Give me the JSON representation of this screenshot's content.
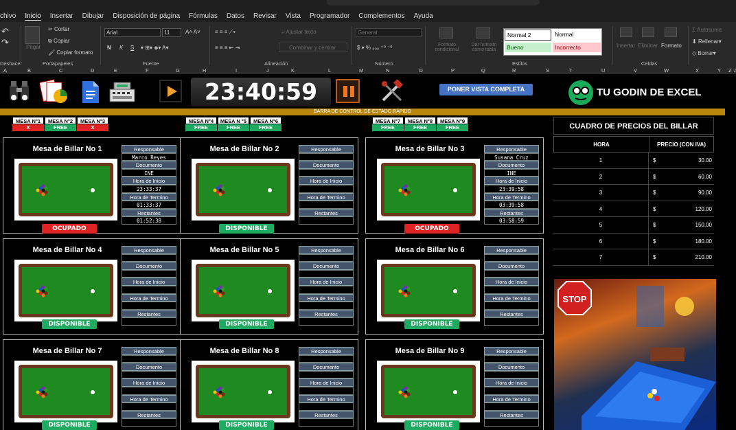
{
  "ribbon": {
    "tabs": [
      "chivo",
      "Inicio",
      "Insertar",
      "Dibujar",
      "Disposición de página",
      "Fórmulas",
      "Datos",
      "Revisar",
      "Vista",
      "Programador",
      "Complementos",
      "Ayuda"
    ],
    "active_tab": "Inicio",
    "undo_label": "Deshacer",
    "clipboard": {
      "cut": "Cortar",
      "copy": "Copiar",
      "format_painter": "Copiar formato",
      "paste": "Pegar",
      "group": "Portapapeles"
    },
    "font": {
      "family": "Arial",
      "size": "11",
      "bold": "N",
      "italic": "K",
      "underline": "S",
      "group": "Fuente"
    },
    "alignment": {
      "wrap": "Ajustar texto",
      "merge": "Combinar y centrar",
      "group": "Alineación"
    },
    "number": {
      "format": "General",
      "group": "Número"
    },
    "styles": {
      "cond_format": "Formato condicional",
      "format_table": "Dar formato como tabla",
      "normal2": "Normal 2",
      "normal": "Normal",
      "bueno": "Bueno",
      "incorrecto": "Incorrecto",
      "group": "Estilos"
    },
    "cells": {
      "insert": "Insertar",
      "delete": "Eliminar",
      "format": "Formato",
      "group": "Celdas"
    },
    "editing": {
      "autosum": "Autosuma",
      "fill": "Rellenar",
      "clear": "Borrar"
    },
    "columns": [
      "A",
      "B",
      "C",
      "D",
      "E",
      "F",
      "G",
      "H",
      "I",
      "J",
      "K",
      "L",
      "M",
      "N",
      "O",
      "P",
      "Q",
      "R",
      "S",
      "T",
      "U",
      "V",
      "W",
      "X",
      "Y",
      "Z",
      "AA"
    ]
  },
  "clock": "23:40:59",
  "vista_button": "PONER VISTA COMPLETA",
  "brand": "TU GODIN DE EXCEL",
  "status_bar_title": "BARRA DE CONTROL DE ESTADO RÁPIDO",
  "quick_status": [
    [
      {
        "label": "MESA N°1",
        "state": "X"
      },
      {
        "label": "MESA N°2",
        "state": "FREE"
      },
      {
        "label": "MESA N°3",
        "state": "X"
      }
    ],
    [
      {
        "label": "MESA N°4",
        "state": "FREE"
      },
      {
        "label": "MESA N °5",
        "state": "FREE"
      },
      {
        "label": "MESA N°6",
        "state": "FREE"
      }
    ],
    [
      {
        "label": "MESA N°7",
        "state": "FREE"
      },
      {
        "label": "MESA N°8",
        "state": "FREE"
      },
      {
        "label": "MESA N°9",
        "state": "FREE"
      }
    ]
  ],
  "labels": {
    "responsable": "Responsable",
    "documento": "Documento",
    "inicio": "Hora de Inicio",
    "termino": "Hora de Termino",
    "restantes": "Restantes"
  },
  "mesas": [
    {
      "title": "Mesa de Billar No 1",
      "status": "OCUPADO",
      "responsable": "Marco Reyes",
      "documento": "INE",
      "inicio": "23:33:37",
      "termino": "01:33:37",
      "restantes": "01:52:38"
    },
    {
      "title": "Mesa de Billar No 2",
      "status": "DISPONIBLE",
      "responsable": "",
      "documento": "",
      "inicio": "",
      "termino": "",
      "restantes": ""
    },
    {
      "title": "Mesa de Billar No 3",
      "status": "OCUPADO",
      "responsable": "Susana Cruz",
      "documento": "INE",
      "inicio": "23:39:58",
      "termino": "03:39:58",
      "restantes": "03:58:59"
    },
    {
      "title": "Mesa de Billar No 4",
      "status": "DISPONIBLE",
      "responsable": "",
      "documento": "",
      "inicio": "",
      "termino": "",
      "restantes": ""
    },
    {
      "title": "Mesa de Billar No 5",
      "status": "DISPONIBLE",
      "responsable": "",
      "documento": "",
      "inicio": "",
      "termino": "",
      "restantes": ""
    },
    {
      "title": "Mesa de Billar No 6",
      "status": "DISPONIBLE",
      "responsable": "",
      "documento": "",
      "inicio": "",
      "termino": "",
      "restantes": ""
    },
    {
      "title": "Mesa de Billar No 7",
      "status": "DISPONIBLE",
      "responsable": "",
      "documento": "",
      "inicio": "",
      "termino": "",
      "restantes": ""
    },
    {
      "title": "Mesa de Billar No 8",
      "status": "DISPONIBLE",
      "responsable": "",
      "documento": "",
      "inicio": "",
      "termino": "",
      "restantes": ""
    },
    {
      "title": "Mesa de Billar No 9",
      "status": "DISPONIBLE",
      "responsable": "",
      "documento": "",
      "inicio": "",
      "termino": "",
      "restantes": ""
    }
  ],
  "prices": {
    "title": "CUADRO DE PRECIOS DEL BILLAR",
    "col_hora": "HORA",
    "col_precio": "PRECIO (CON IVA)",
    "currency": "$",
    "rows": [
      {
        "hora": "1",
        "precio": "30.00"
      },
      {
        "hora": "2",
        "precio": "60.00"
      },
      {
        "hora": "3",
        "precio": "90.00"
      },
      {
        "hora": "4",
        "precio": "120.00"
      },
      {
        "hora": "5",
        "precio": "150.00"
      },
      {
        "hora": "6",
        "precio": "180.00"
      },
      {
        "hora": "7",
        "precio": "210.00"
      }
    ]
  },
  "colors": {
    "busy": "#e02424",
    "free": "#1eaa60",
    "label_bg": "#44546a",
    "banner": "#b8860b",
    "accent_button": "#4472c4"
  }
}
